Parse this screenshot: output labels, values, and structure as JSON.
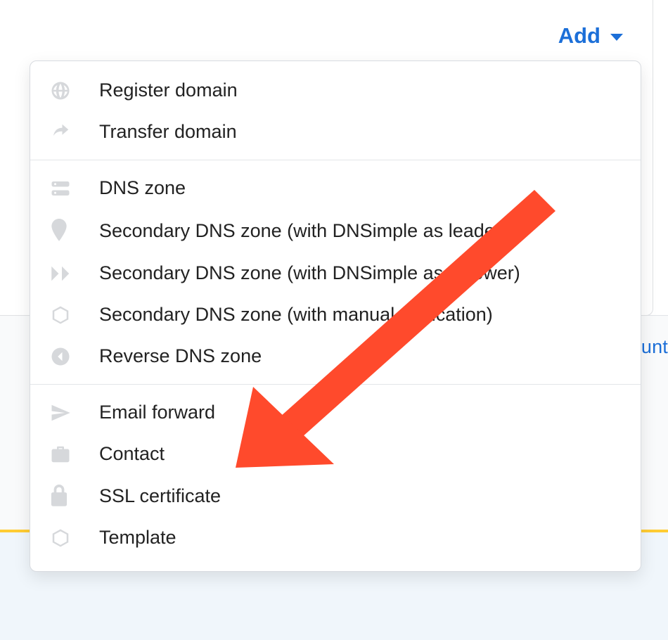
{
  "toolbar": {
    "add_label": "Add"
  },
  "menu": {
    "group1": [
      {
        "icon": "globe-icon",
        "label": "Register domain"
      },
      {
        "icon": "share-icon",
        "label": "Transfer domain"
      }
    ],
    "group2": [
      {
        "icon": "server-icon",
        "label": "DNS zone"
      },
      {
        "icon": "map-marker-icon",
        "label": "Secondary DNS zone (with DNSimple as leader)"
      },
      {
        "icon": "forward-icon",
        "label": "Secondary DNS zone (with DNSimple as follower)"
      },
      {
        "icon": "cube-icon",
        "label": "Secondary DNS zone (with manual replication)"
      },
      {
        "icon": "back-circle-icon",
        "label": "Reverse DNS zone"
      }
    ],
    "group3": [
      {
        "icon": "paper-plane-icon",
        "label": "Email forward"
      },
      {
        "icon": "briefcase-icon",
        "label": "Contact"
      },
      {
        "icon": "lock-icon",
        "label": "SSL certificate"
      },
      {
        "icon": "cube-icon",
        "label": "Template"
      }
    ]
  },
  "background": {
    "link_fragment": "unt"
  },
  "annotation": {
    "arrow_target": "email-forward-item",
    "arrow_color": "#ff4a2c"
  }
}
